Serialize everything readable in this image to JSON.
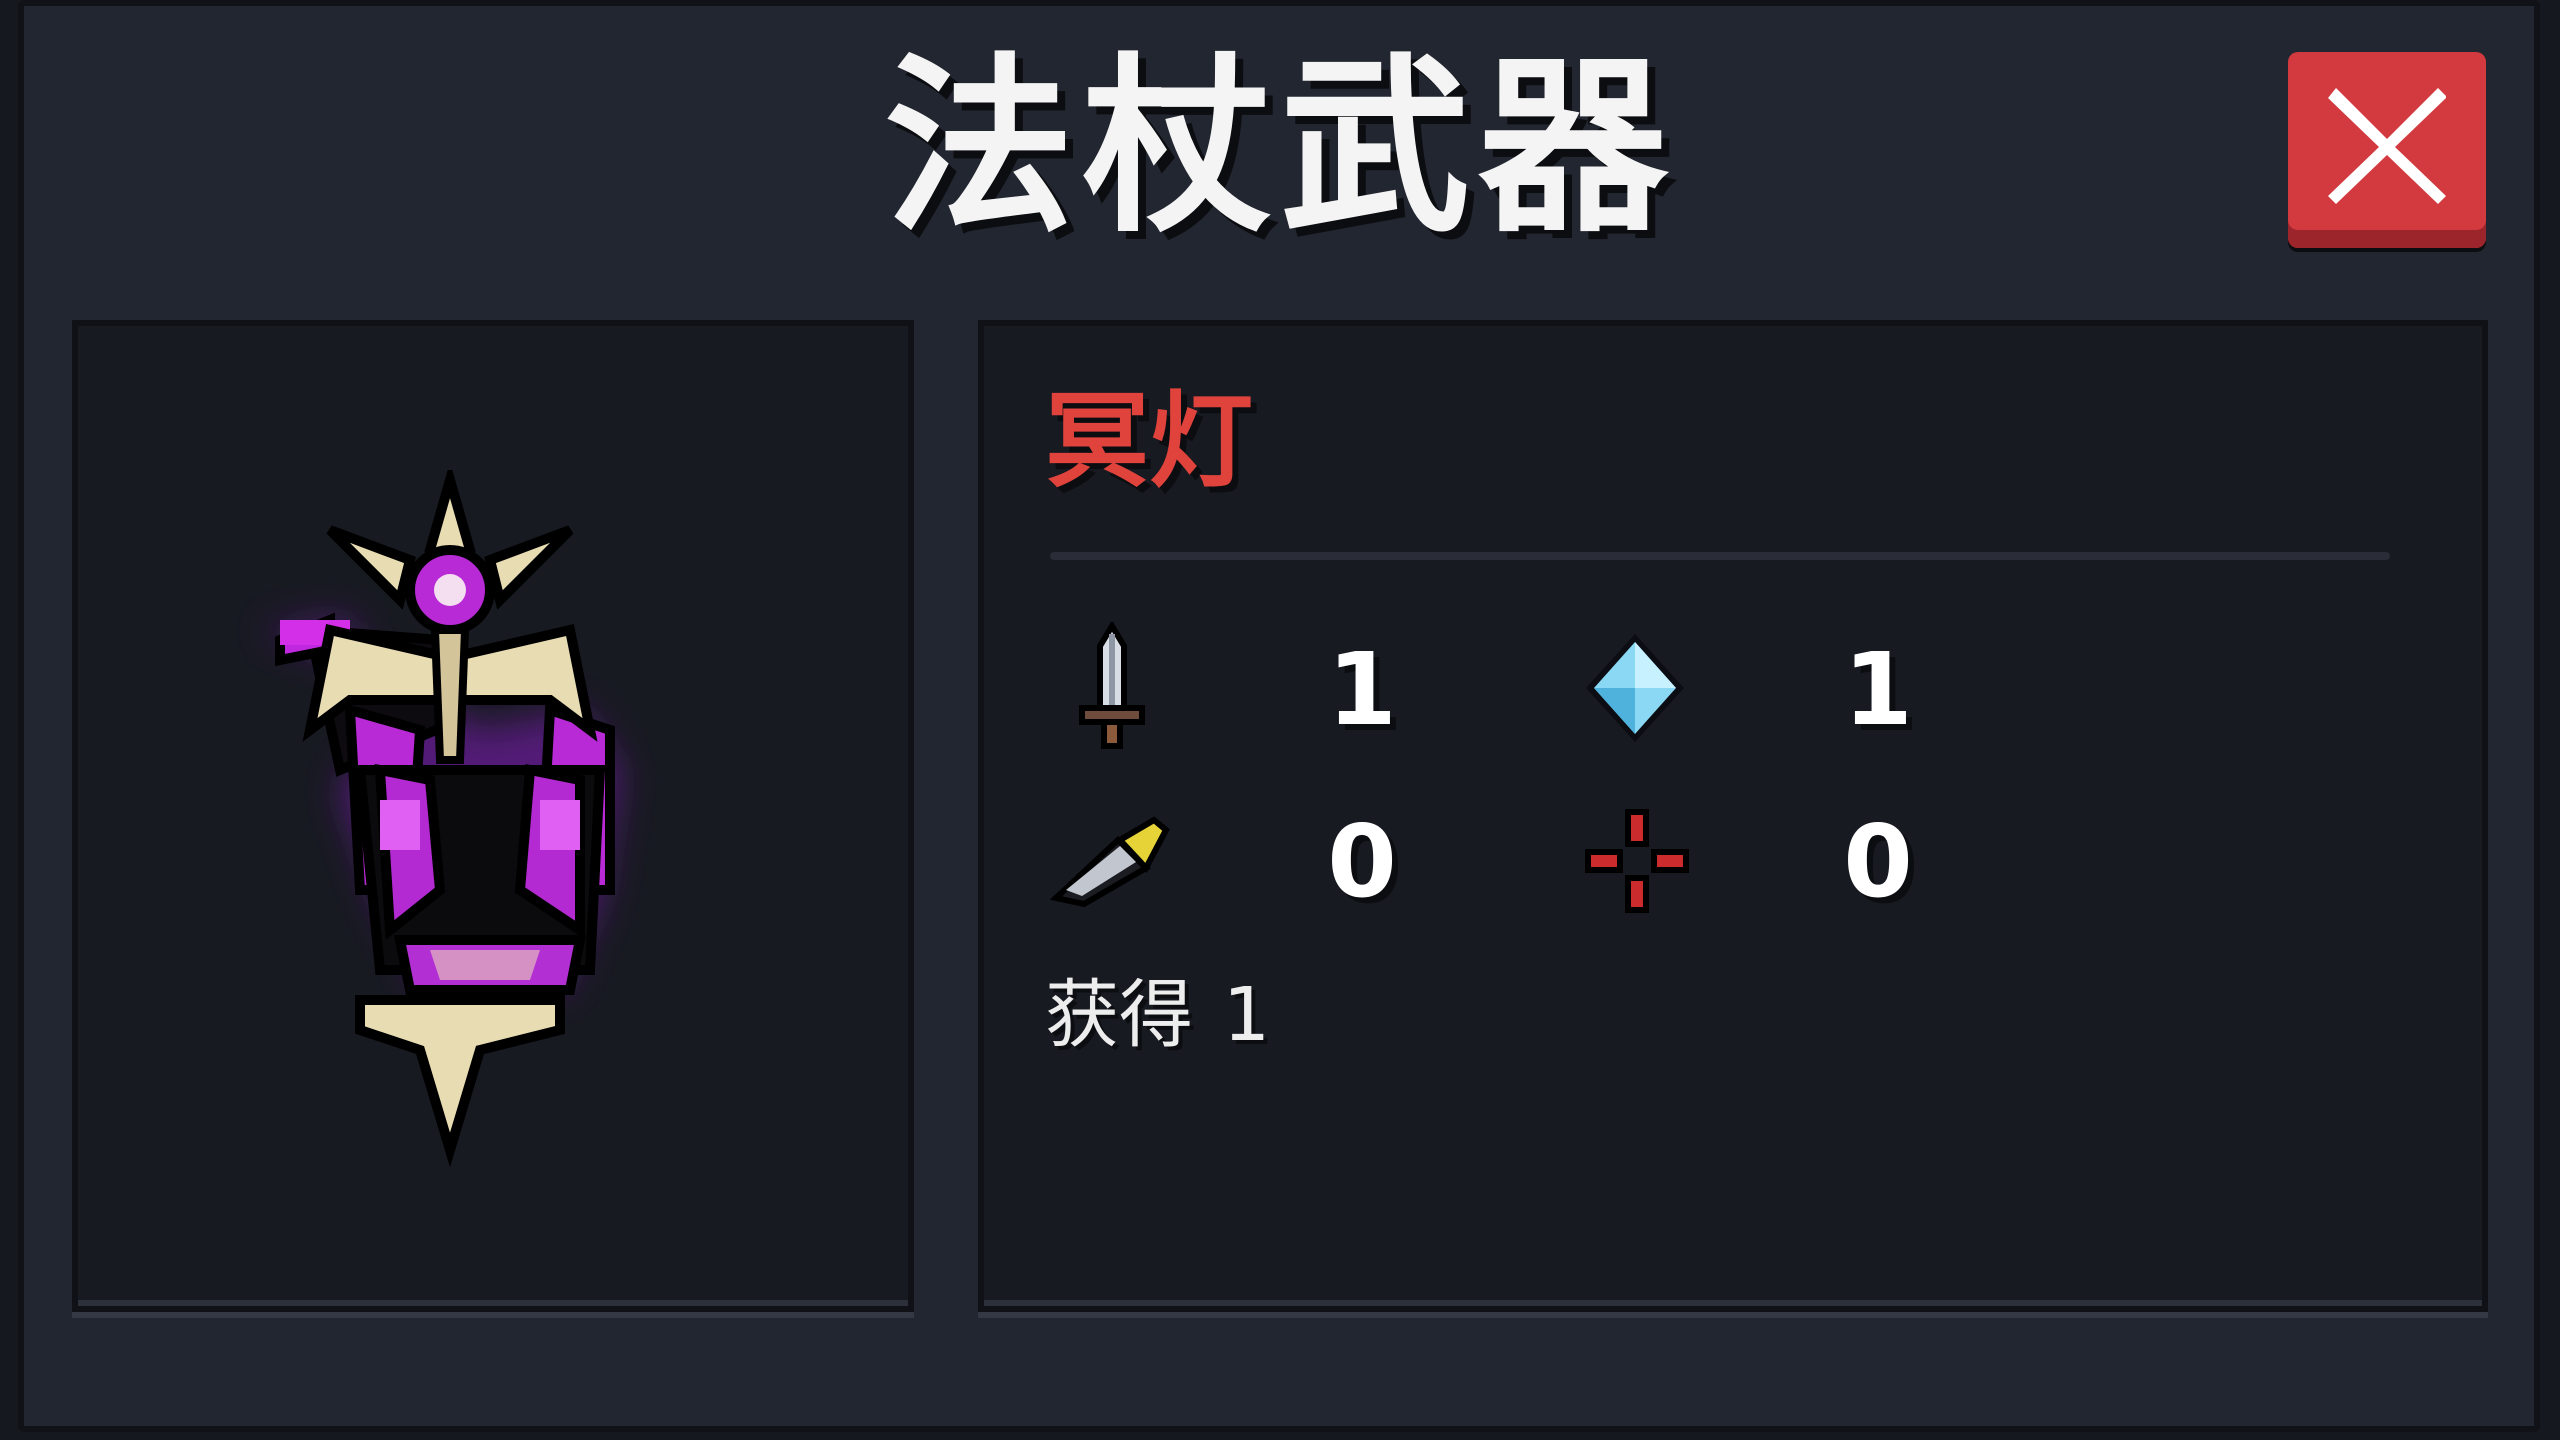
{
  "dialog": {
    "title": "法杖武器",
    "close_icon": "close-x-icon",
    "accent_color": "#d23a3f"
  },
  "weapon": {
    "name": "冥灯",
    "name_color": "#e0433c",
    "image": "purple-lantern-staff-sprite",
    "stats": [
      {
        "icon": "sword-damage-icon",
        "value": "1"
      },
      {
        "icon": "diamond-energy-icon",
        "value": "1"
      },
      {
        "icon": "bullet-crit-icon",
        "value": "0"
      },
      {
        "icon": "crosshair-accuracy-icon",
        "value": "0"
      }
    ],
    "acquired_label": "获得",
    "acquired_count": "1"
  }
}
